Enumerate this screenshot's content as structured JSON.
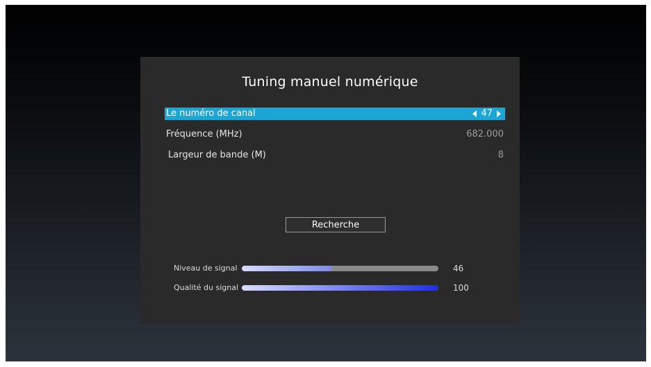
{
  "title": "Tuning manuel numérique",
  "rows": [
    {
      "label": "Le numéro de canal",
      "value": "47",
      "selected": true
    },
    {
      "label": "Fréquence (MHz)",
      "value": "682.000",
      "selected": false
    },
    {
      "label": "Largeur de bande (M)",
      "value": "8",
      "selected": false
    }
  ],
  "search_label": "Recherche",
  "meters": [
    {
      "label": "Niveau de signal",
      "value": "46",
      "level": 0.46
    },
    {
      "label": "Qualité du signal",
      "value": "100",
      "level": 1.0
    }
  ],
  "colors": {
    "selected_row": "#1ba6d6",
    "panel": "#2a2a2a",
    "signal_fill_start": "#d8dcff",
    "signal_fill_end": "#7e8ae8",
    "quality_fill_end": "#1f2ee0",
    "track": "#8a8a8a"
  },
  "icons": {
    "decrement": "triangle-left-icon",
    "increment": "triangle-right-icon"
  }
}
